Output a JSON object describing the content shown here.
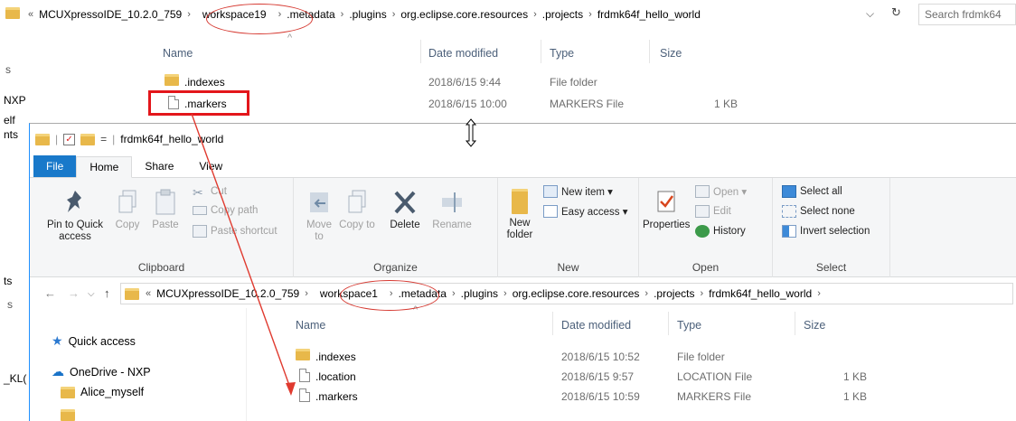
{
  "background_window": {
    "address_back_glyph": "«",
    "breadcrumbs": [
      "MCUXpressoIDE_10.2.0_759",
      "workspace19",
      ".metadata",
      ".plugins",
      "org.eclipse.core.resources",
      ".projects",
      "frdmk64f_hello_world"
    ],
    "dropdown_glyph": "⌵",
    "refresh_glyph": "↻",
    "search_placeholder": "Search frdmk64",
    "columns": {
      "name": "Name",
      "date": "Date modified",
      "type": "Type",
      "size": "Size"
    },
    "sort_glyph": "^",
    "files": [
      {
        "name": ".indexes",
        "date": "2018/6/15 9:44",
        "type": "File folder",
        "size": "",
        "icon": "folder-icon"
      },
      {
        "name": ".markers",
        "date": "2018/6/15 10:00",
        "type": "MARKERS File",
        "size": "1 KB",
        "icon": "file-icon"
      }
    ],
    "side_fragments": [
      "s",
      "NXP",
      "elf",
      "nts",
      "ts",
      "s",
      "_KL("
    ]
  },
  "foreground_window": {
    "title": "frdmk64f_hello_world",
    "menu_tabs": [
      "File",
      "Home",
      "Share",
      "View"
    ],
    "ribbon": {
      "clipboard": {
        "label": "Clipboard",
        "pin": "Pin to Quick access",
        "copy": "Copy",
        "paste": "Paste",
        "cut": "Cut",
        "copy_path": "Copy path",
        "paste_shortcut": "Paste shortcut"
      },
      "organize": {
        "label": "Organize",
        "move_to": "Move to",
        "copy_to": "Copy to",
        "delete": "Delete",
        "rename": "Rename"
      },
      "new": {
        "label": "New",
        "new_folder": "New folder",
        "new_item": "New item ▾",
        "easy_access": "Easy access ▾"
      },
      "open": {
        "label": "Open",
        "properties": "Properties",
        "open": "Open ▾",
        "edit": "Edit",
        "history": "History"
      },
      "select": {
        "label": "Select",
        "select_all": "Select all",
        "select_none": "Select none",
        "invert": "Invert selection"
      }
    },
    "address_back_glyph": "«",
    "breadcrumbs": [
      "MCUXpressoIDE_10.2.0_759",
      "workspace1",
      ".metadata",
      ".plugins",
      "org.eclipse.core.resources",
      ".projects",
      "frdmk64f_hello_world"
    ],
    "columns": {
      "name": "Name",
      "date": "Date modified",
      "type": "Type",
      "size": "Size"
    },
    "sort_glyph": "^",
    "files": [
      {
        "name": ".indexes",
        "date": "2018/6/15 10:52",
        "type": "File folder",
        "size": "",
        "icon": "folder-icon"
      },
      {
        "name": ".location",
        "date": "2018/6/15 9:57",
        "type": "LOCATION File",
        "size": "1 KB",
        "icon": "file-icon"
      },
      {
        "name": ".markers",
        "date": "2018/6/15 10:59",
        "type": "MARKERS File",
        "size": "1 KB",
        "icon": "file-icon"
      }
    ],
    "nav_pane": [
      "Quick access",
      "OneDrive - NXP",
      "Alice_myself"
    ]
  },
  "annotation_colors": {
    "highlight": "#e3161b",
    "ellipse": "#d63a32",
    "arrow": "#e03a2f"
  }
}
